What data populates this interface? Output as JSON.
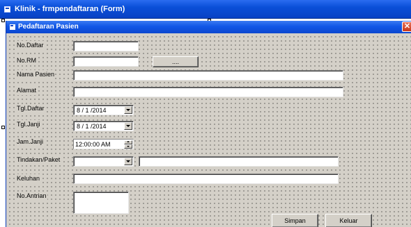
{
  "outer_window": {
    "title": "Klinik - frmpendaftaran (Form)"
  },
  "form": {
    "title": "Pedaftaran Pasien",
    "close_glyph": "✕"
  },
  "fields": {
    "no_daftar_label": "No.Daftar",
    "no_rm_label": "No.RM",
    "browse_label": "....",
    "nama_pasien_label": "Nama Pasien",
    "alamat_label": "Alamat",
    "tgl_daftar_label": "Tgl.Daftar",
    "tgl_daftar_value": "8 / 1 /2014",
    "tgl_janji_label": "Tgl.Janji",
    "tgl_janji_value": "8 / 1 /2014",
    "jam_janji_label": "Jam.Janji",
    "jam_janji_value": "12:00:00 AM",
    "tindakan_label": "Tindakan/Paket",
    "keluhan_label": "Keluhan",
    "no_antrian_label": "No.Antrian"
  },
  "buttons": {
    "simpan": "Simpan",
    "keluar": "Keluar"
  },
  "colors": {
    "title_bar": "#0a4fd8",
    "form_bg": "#d4d0c8",
    "close_button": "#d9542f"
  }
}
